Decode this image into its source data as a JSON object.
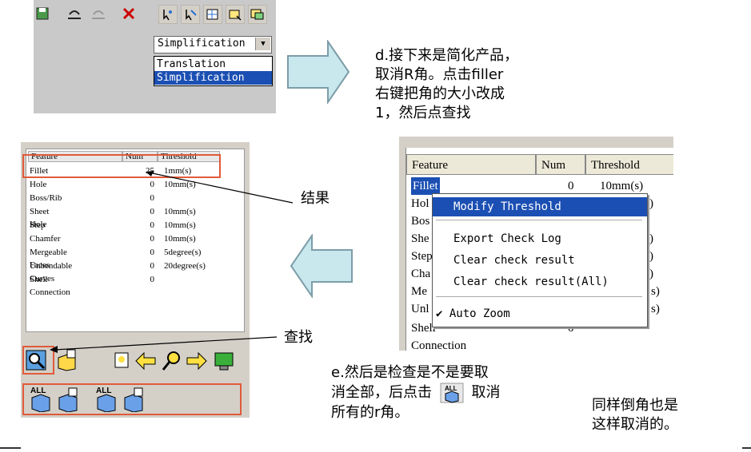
{
  "shot1": {
    "combo_value": "Simplification",
    "combo_arrow": "▼",
    "dropdown_options": [
      "Translation",
      "Simplification"
    ],
    "selected_index": 1
  },
  "note_d": {
    "lines": [
      "d.接下来是简化产品，",
      "取消R角。点击filler",
      "右键把角的大小改成",
      "1，然后点查找"
    ]
  },
  "label_result": "结果",
  "label_find": "查找",
  "note_e": {
    "line1": "e.然后是检查是不是要取",
    "line2_a": "消全部，后点击",
    "line2_b": "取消",
    "line3": "所有的r角。"
  },
  "note_same": {
    "line1": "同样倒角也是",
    "line2": "这样取消的。"
  },
  "left_table": {
    "headers": [
      "Feature",
      "Num",
      "Threshold"
    ],
    "rows": [
      {
        "name": "Fillet",
        "num": "25",
        "th": "1mm(s)"
      },
      {
        "name": "Hole",
        "num": "0",
        "th": "10mm(s)"
      },
      {
        "name": "Boss/Rib",
        "num": "0",
        "th": ""
      },
      {
        "name": "Sheet Hole",
        "num": "0",
        "th": "10mm(s)"
      },
      {
        "name": "Step",
        "num": "0",
        "th": "10mm(s)"
      },
      {
        "name": "Chamfer",
        "num": "0",
        "th": "10mm(s)"
      },
      {
        "name": "Mergeable Faces",
        "num": "0",
        "th": "5degree(s)"
      },
      {
        "name": "Unbendable Curves",
        "num": "0",
        "th": "20degree(s)"
      },
      {
        "name": "Shell Connection",
        "num": "0",
        "th": ""
      }
    ]
  },
  "right_table": {
    "headers": [
      "Feature",
      "Num",
      "Threshold"
    ],
    "rows": [
      {
        "name": "Fillet",
        "num": "0",
        "th": "10mm(s)"
      },
      {
        "name": "Hol",
        "num": "",
        "th": ")"
      },
      {
        "name": "Bos",
        "num": "",
        "th": ""
      },
      {
        "name": "She",
        "num": "",
        "th": ")"
      },
      {
        "name": "Step",
        "num": "",
        "th": ")"
      },
      {
        "name": "Cha",
        "num": "",
        "th": ")"
      },
      {
        "name": "Me",
        "num": "",
        "th": "s)"
      },
      {
        "name": "Unl",
        "num": "",
        "th": "s)"
      },
      {
        "name": "Shell Connection",
        "num": "0",
        "th": ""
      }
    ]
  },
  "context_menu": {
    "items": [
      "Modify Threshold",
      "Export Check Log",
      "Clear check result",
      "Clear check result(All)",
      "Auto Zoom"
    ],
    "check_mark": "✔"
  },
  "colors": {
    "arrow_fill": "#c8e8ee",
    "arrow_stroke": "#7d9da8",
    "highlight": "#1b4fb3",
    "red_box": "#e15a3a"
  }
}
